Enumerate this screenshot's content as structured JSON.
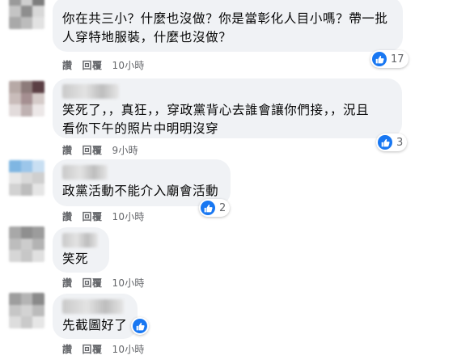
{
  "comments": [
    {
      "text": "你在共三小？什麼也沒做？你是當彰化人目小嗎？帶一批\n人穿特地服裝，什麼也沒做？",
      "like_count": "17",
      "actions": {
        "like": "讚",
        "reply": "回覆",
        "time": "10小時"
      }
    },
    {
      "text": "笑死了，，真狂，，穿政黨背心去誰會讓你們接，，況且\n看你下午的照片中明明沒穿",
      "like_count": "3",
      "actions": {
        "like": "讚",
        "reply": "回覆",
        "time": "9小時"
      }
    },
    {
      "text": "政黨活動不能介入廟會活動",
      "like_count": "2",
      "actions": {
        "like": "讚",
        "reply": "回覆",
        "time": "10小時"
      }
    },
    {
      "text": "笑死",
      "like_count": "",
      "actions": {
        "like": "讚",
        "reply": "回覆",
        "time": "10小時"
      }
    },
    {
      "text": "先截圖好了",
      "like_count": "",
      "actions": {
        "like": "讚",
        "reply": "回覆",
        "time": "10小時"
      }
    }
  ],
  "colors": {
    "bubble": "#f0f2f5",
    "like_blue": "#1877f2",
    "meta_text": "#65676b",
    "body_text": "#050505"
  },
  "icons": {
    "like": "like-thumb-icon"
  }
}
